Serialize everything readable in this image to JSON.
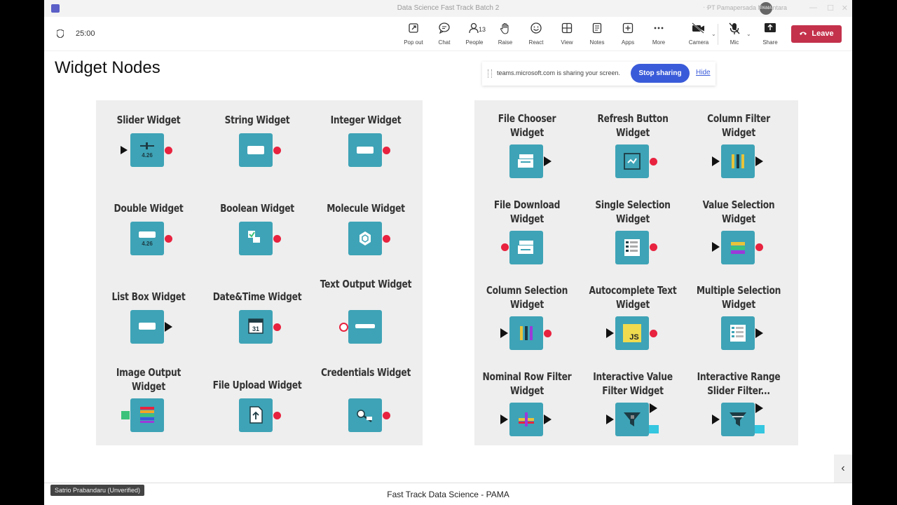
{
  "window": {
    "title": "Data Science Fast Track Batch 2",
    "org": "PT Pamapersada Nusantara",
    "org_avatar": "PAMA"
  },
  "toolbar": {
    "timer": "25:00",
    "pop_out": "Pop out",
    "chat": "Chat",
    "people": "People",
    "people_count": "13",
    "raise": "Raise",
    "react": "React",
    "view": "View",
    "notes": "Notes",
    "apps": "Apps",
    "more": "More",
    "camera": "Camera",
    "mic": "Mic",
    "share": "Share",
    "leave": "Leave"
  },
  "share_banner": {
    "message": "teams.microsoft.com is sharing your screen.",
    "stop_label": "Stop sharing",
    "hide_label": "Hide"
  },
  "slide": {
    "title": "Widget Nodes",
    "left_widgets": [
      {
        "label": "Slider Widget",
        "icon": "slider-icon",
        "badge": "4.26"
      },
      {
        "label": "String Widget",
        "icon": "string-icon"
      },
      {
        "label": "Integer Widget",
        "icon": "integer-icon"
      },
      {
        "label": "Double Widget",
        "icon": "double-icon",
        "badge": "4.26"
      },
      {
        "label": "Boolean Widget",
        "icon": "boolean-icon"
      },
      {
        "label": "Molecule Widget",
        "icon": "molecule-icon"
      },
      {
        "label": "List Box Widget",
        "icon": "listbox-icon"
      },
      {
        "label": "Date&Time Widget",
        "icon": "calendar-icon",
        "badge": "31"
      },
      {
        "label": "Text Output Widget",
        "icon": "text-output-icon"
      },
      {
        "label": "Image Output Widget",
        "icon": "image-output-icon"
      },
      {
        "label": "File Upload Widget",
        "icon": "file-upload-icon"
      },
      {
        "label": "Credentials Widget",
        "icon": "credentials-icon"
      }
    ],
    "right_widgets": [
      {
        "label": "File Chooser Widget",
        "icon": "file-chooser-icon"
      },
      {
        "label": "Refresh Button Widget",
        "icon": "refresh-icon"
      },
      {
        "label": "Column Filter Widget",
        "icon": "column-filter-icon"
      },
      {
        "label": "File Download Widget",
        "icon": "file-download-icon"
      },
      {
        "label": "Single Selection Widget",
        "icon": "single-selection-icon"
      },
      {
        "label": "Value Selection Widget",
        "icon": "value-selection-icon"
      },
      {
        "label": "Column Selection Widget",
        "icon": "column-selection-icon"
      },
      {
        "label": "Autocomplete Text Widget",
        "icon": "js-icon",
        "badge": "JS"
      },
      {
        "label": "Multiple Selection Widget",
        "icon": "multiple-selection-icon"
      },
      {
        "label": "Nominal Row Filter Widget",
        "icon": "nominal-filter-icon"
      },
      {
        "label": "Interactive Value Filter Widget",
        "icon": "value-filter-icon"
      },
      {
        "label": "Interactive Range Slider Filter...",
        "icon": "range-slider-icon"
      }
    ]
  },
  "footer": {
    "caption": "Fast Track Data Science - PAMA",
    "participant": "Satrio Prabandaru (Unverified)"
  }
}
